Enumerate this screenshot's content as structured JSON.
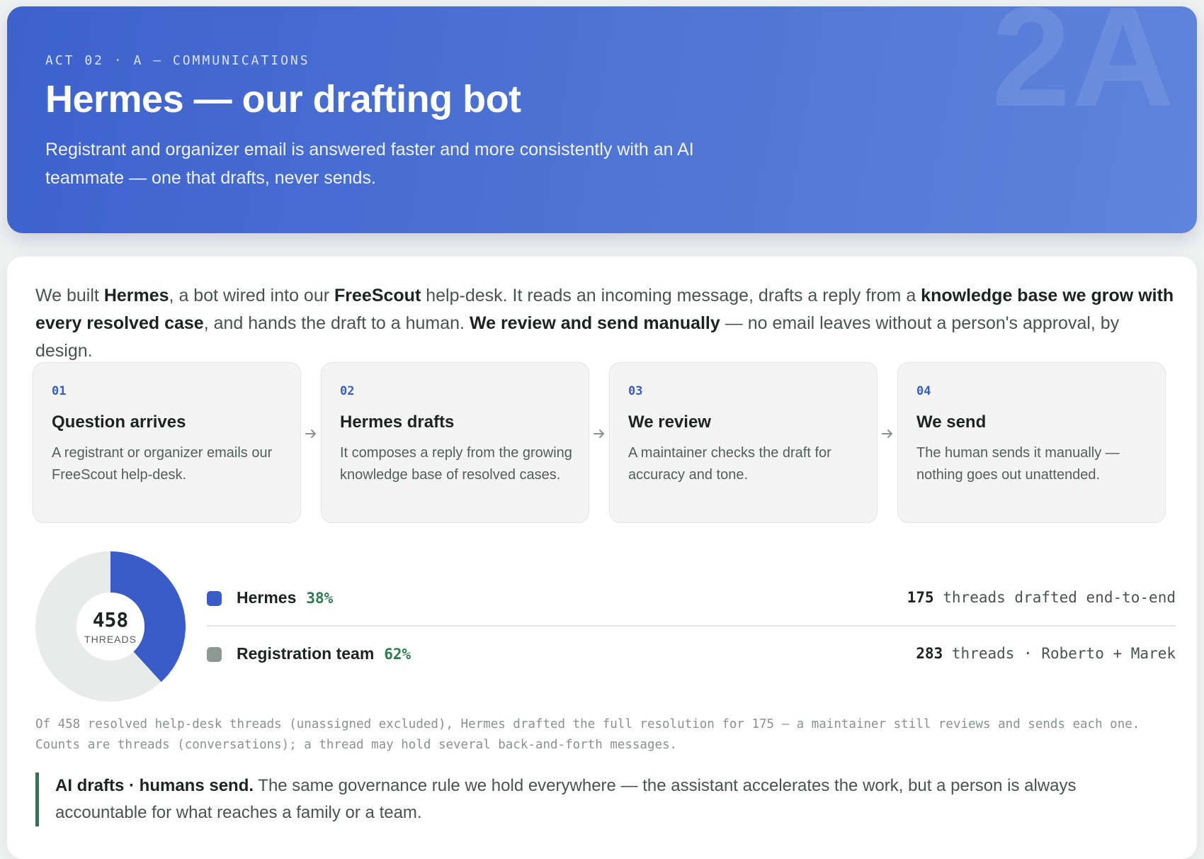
{
  "hero": {
    "eyebrow": "ACT 02 · A — COMMUNICATIONS",
    "title": "Hermes — our drafting bot",
    "subtitle": "Registrant and organizer email is answered faster and more consistently with an AI teammate — one that drafts, never sends.",
    "watermark": "2A",
    "gradient_start": "#3d62cd",
    "gradient_end": "#5f84db"
  },
  "intro": {
    "t1": "We built ",
    "b1": "Hermes",
    "t2": ", a bot wired into our ",
    "b2": "FreeScout",
    "t3": " help-desk. It reads an incoming message, drafts a reply from a ",
    "b3": "knowledge base we grow with every resolved case",
    "t4": ", and hands the draft to a human. ",
    "b4": "We review and send manually",
    "t5": " — no email leaves without a person's approval, by design."
  },
  "steps": [
    {
      "num": "01",
      "title": "Question arrives",
      "desc": "A registrant or organizer emails our FreeScout help-desk."
    },
    {
      "num": "02",
      "title": "Hermes drafts",
      "desc": "It composes a reply from the growing knowledge base of resolved cases."
    },
    {
      "num": "03",
      "title": "We review",
      "desc": "A maintainer checks the draft for accuracy and tone."
    },
    {
      "num": "04",
      "title": "We send",
      "desc": "The human sends it manually — nothing goes out unattended."
    }
  ],
  "split": {
    "total": "458",
    "total_label": "THREADS",
    "rows": [
      {
        "name": "Hermes",
        "pct": "38%",
        "count": "175",
        "detail": " threads drafted end-to-end",
        "color": "#3a5cc6"
      },
      {
        "name": "Registration team",
        "pct": "62%",
        "count": "283",
        "detail": " threads · Roberto + Marek",
        "color": "#8d9993"
      }
    ]
  },
  "chart_data": {
    "type": "pie",
    "categories": [
      "Hermes",
      "Registration team"
    ],
    "values": [
      175,
      283
    ],
    "total": 458,
    "colors": [
      "#3a5cc6",
      "#e8ebea"
    ]
  },
  "footnote": "Of 458 resolved help-desk threads (unassigned excluded), Hermes drafted the full resolution for 175 — a maintainer still reviews and sends each one. Counts are threads (conversations); a thread may hold several back-and-forth messages.",
  "callout": {
    "bold": "AI drafts · humans send.",
    "text": " The same governance rule we hold everywhere — the assistant accelerates the work, but a person is always accountable for what reaches a family or a team."
  },
  "icons": {
    "step_arrow": "arrow-right-icon"
  }
}
